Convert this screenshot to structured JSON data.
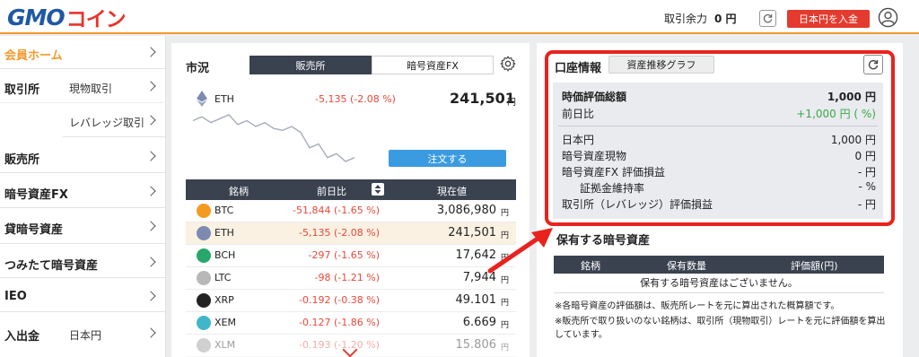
{
  "header": {
    "logo_latin": "GMO",
    "logo_kana": "コイン",
    "balance_label": "取引余力",
    "balance_value": "0 円",
    "deposit_button": "日本円を入金"
  },
  "sidebar": {
    "items": [
      {
        "label": "会員ホーム",
        "sub": ""
      },
      {
        "label": "取引所",
        "sub": "現物取引"
      },
      {
        "label": "",
        "sub": "レバレッジ取引"
      },
      {
        "label": "販売所",
        "sub": ""
      },
      {
        "label": "暗号資産FX",
        "sub": ""
      },
      {
        "label": "貸暗号資産",
        "sub": ""
      },
      {
        "label": "つみたて暗号資産",
        "sub": ""
      },
      {
        "label": "IEO",
        "sub": ""
      },
      {
        "label": "入出金",
        "sub": "日本円"
      }
    ]
  },
  "market": {
    "title": "市況",
    "tabs": [
      "販売所",
      "暗号資産FX"
    ],
    "selected": {
      "symbol": "ETH",
      "change": "-5,135 (-2.08 %)",
      "price": "241,501",
      "yen": "円"
    },
    "order_button": "注文する",
    "columns": [
      "銘柄",
      "前日比",
      "現在値"
    ],
    "rows": [
      {
        "symbol": "BTC",
        "change": "-51,844 (-1.65 %)",
        "price": "3,086,980",
        "yen": "円",
        "color": "#f49a23"
      },
      {
        "symbol": "ETH",
        "change": "-5,135 (-2.08 %)",
        "price": "241,501",
        "yen": "円",
        "color": "#7d8bb0"
      },
      {
        "symbol": "BCH",
        "change": "-297 (-1.65 %)",
        "price": "17,642",
        "yen": "円",
        "color": "#27a86a"
      },
      {
        "symbol": "LTC",
        "change": "-98 (-1.21 %)",
        "price": "7,944",
        "yen": "円",
        "color": "#b8b8b8"
      },
      {
        "symbol": "XRP",
        "change": "-0.192 (-0.38 %)",
        "price": "49.101",
        "yen": "円",
        "color": "#222222"
      },
      {
        "symbol": "XEM",
        "change": "-0.127 (-1.86 %)",
        "price": "6.669",
        "yen": "円",
        "color": "#3fb7c9"
      },
      {
        "symbol": "XLM",
        "change": "-0.193 (-1.20 %)",
        "price": "15.806",
        "yen": "円",
        "color": "#999999"
      }
    ],
    "sparkline": [
      250,
      252,
      249,
      251,
      253,
      248,
      250,
      247,
      249,
      246,
      245,
      247,
      244,
      236,
      238,
      231,
      233,
      229,
      231
    ]
  },
  "account": {
    "title": "口座情報",
    "graph_button": "資産推移グラフ",
    "rows": [
      {
        "label": "時価評価総額",
        "value": "1,000 円",
        "bold": true
      },
      {
        "label": "前日比",
        "value": "+1,000 円 ( %)",
        "green": true
      },
      {
        "label": "日本円",
        "value": "1,000 円"
      },
      {
        "label": "暗号資産現物",
        "value": "0 円"
      },
      {
        "label": "暗号資産FX 評価損益",
        "value": "- 円"
      },
      {
        "label": "証拠金維持率",
        "value": "- %",
        "indent": true
      },
      {
        "label": "取引所（レバレッジ）評価損益",
        "value": "- 円"
      }
    ],
    "holdings_title": "保有する暗号資産",
    "holdings_columns": [
      "銘柄",
      "保有数量",
      "評価額(円)"
    ],
    "holdings_empty": "保有する暗号資産はございません。",
    "notes": [
      "※各暗号資産の評価額は、販売所レートを元に算出された概算額です。",
      "※販売所で取り扱いのない銘柄は、取引所（現物取引）レートを元に評価額を算出しています。"
    ]
  },
  "colors": {
    "accent": "#f29a2e",
    "red": "#e43b2f",
    "navy": "#3a4250",
    "blue": "#3b9be0",
    "green": "#3aa845"
  }
}
